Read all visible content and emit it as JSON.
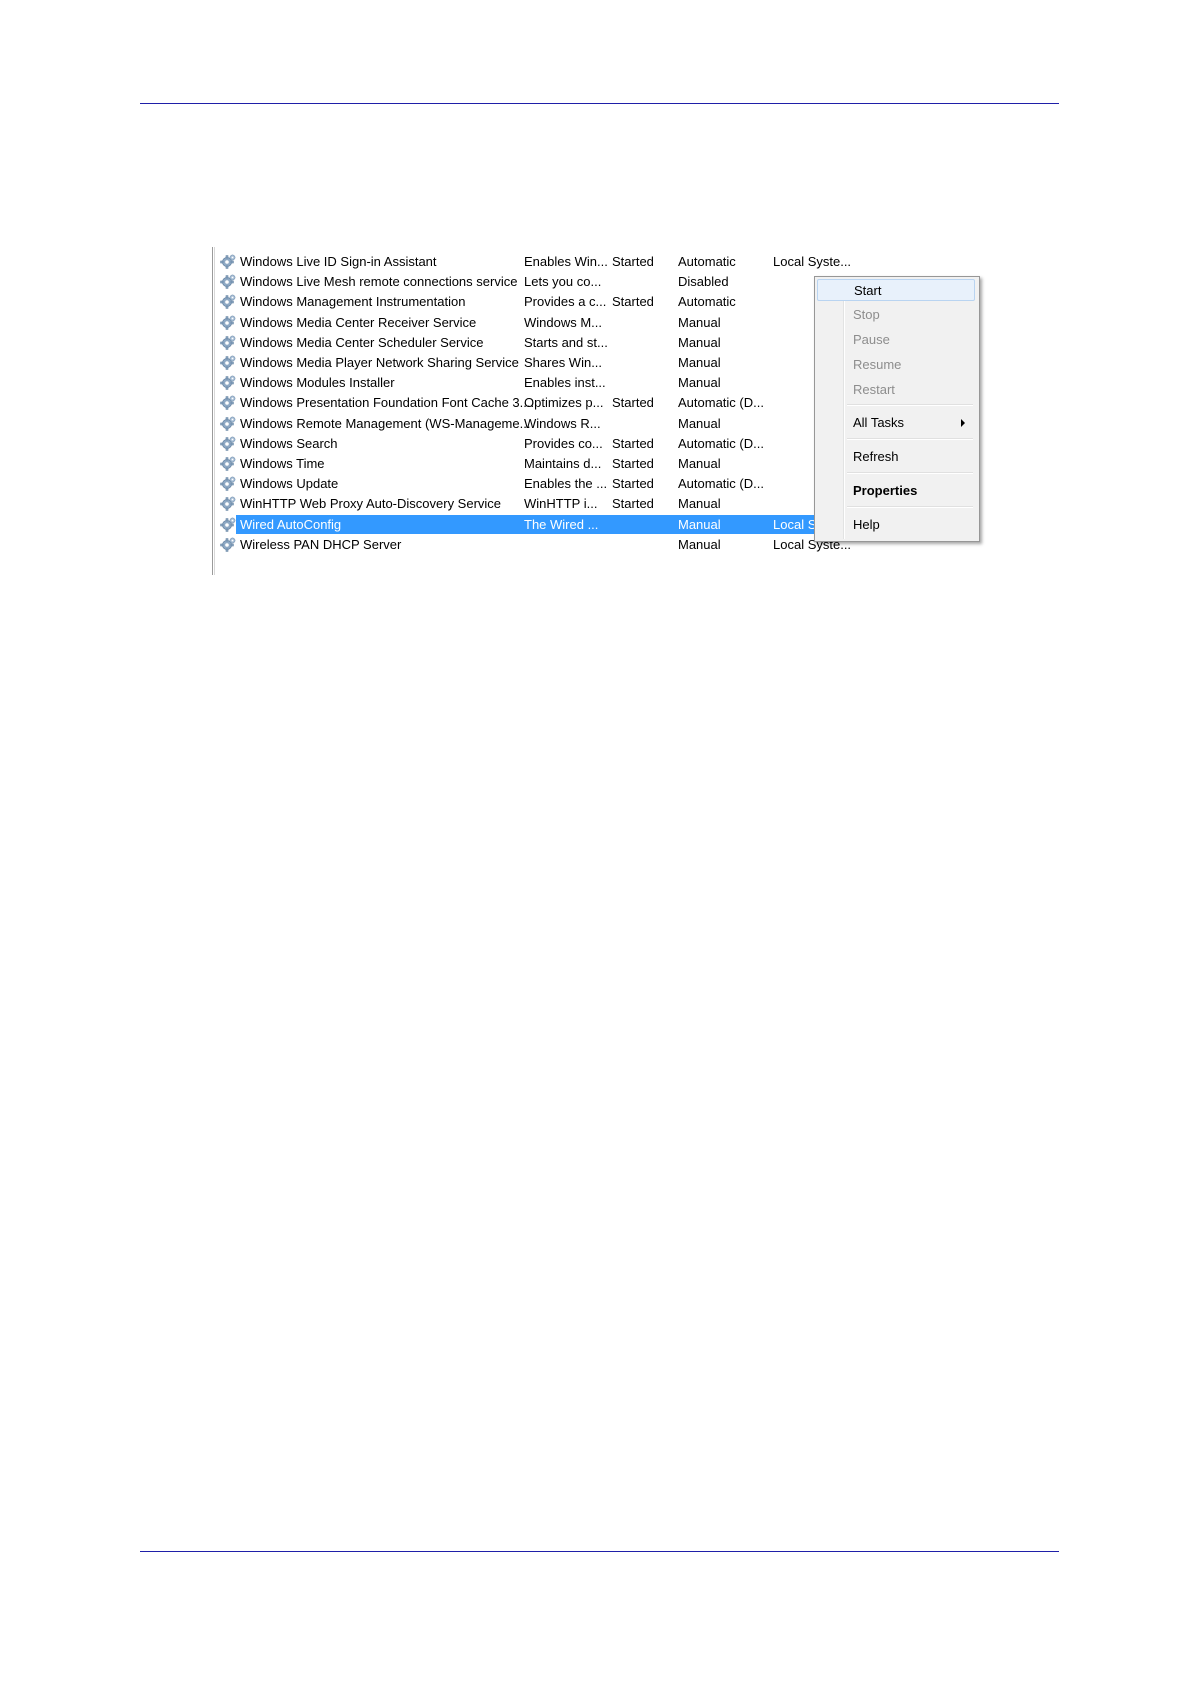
{
  "services": [
    {
      "name": "Windows Live ID Sign-in Assistant",
      "description": "Enables Win...",
      "status": "Started",
      "startup": "Automatic",
      "logon": "Local Syste...",
      "selected": false
    },
    {
      "name": "Windows Live Mesh remote connections service",
      "description": "Lets you co...",
      "status": "",
      "startup": "Disabled",
      "logon": "",
      "selected": false
    },
    {
      "name": "Windows Management Instrumentation",
      "description": "Provides a c...",
      "status": "Started",
      "startup": "Automatic",
      "logon": "",
      "selected": false
    },
    {
      "name": "Windows Media Center Receiver Service",
      "description": "Windows M...",
      "status": "",
      "startup": "Manual",
      "logon": "",
      "selected": false
    },
    {
      "name": "Windows Media Center Scheduler Service",
      "description": "Starts and st...",
      "status": "",
      "startup": "Manual",
      "logon": "",
      "selected": false
    },
    {
      "name": "Windows Media Player Network Sharing Service",
      "description": "Shares Win...",
      "status": "",
      "startup": "Manual",
      "logon": "",
      "selected": false
    },
    {
      "name": "Windows Modules Installer",
      "description": "Enables inst...",
      "status": "",
      "startup": "Manual",
      "logon": "",
      "selected": false
    },
    {
      "name": "Windows Presentation Foundation Font Cache 3....",
      "description": "Optimizes p...",
      "status": "Started",
      "startup": "Automatic (D...",
      "logon": "",
      "selected": false
    },
    {
      "name": "Windows Remote Management (WS-Manageme...",
      "description": "Windows R...",
      "status": "",
      "startup": "Manual",
      "logon": "",
      "selected": false
    },
    {
      "name": "Windows Search",
      "description": "Provides co...",
      "status": "Started",
      "startup": "Automatic (D...",
      "logon": "",
      "selected": false
    },
    {
      "name": "Windows Time",
      "description": "Maintains d...",
      "status": "Started",
      "startup": "Manual",
      "logon": "",
      "selected": false
    },
    {
      "name": "Windows Update",
      "description": "Enables the ...",
      "status": "Started",
      "startup": "Automatic (D...",
      "logon": "",
      "selected": false
    },
    {
      "name": "WinHTTP Web Proxy Auto-Discovery Service",
      "description": "WinHTTP i...",
      "status": "Started",
      "startup": "Manual",
      "logon": "",
      "selected": false
    },
    {
      "name": "Wired AutoConfig",
      "description": "The Wired ...",
      "status": "",
      "startup": "Manual",
      "logon": "Local Syste...",
      "selected": true
    },
    {
      "name": "Wireless PAN DHCP Server",
      "description": "",
      "status": "",
      "startup": "Manual",
      "logon": "Local Syste...",
      "selected": false
    }
  ],
  "context_menu": {
    "start": "Start",
    "stop": "Stop",
    "pause": "Pause",
    "resume": "Resume",
    "restart": "Restart",
    "all_tasks": "All Tasks",
    "refresh": "Refresh",
    "properties": "Properties",
    "help": "Help"
  },
  "colors": {
    "rule": "#1f1fa8",
    "selection": "#3399ff",
    "menu_hover": "#e8f1fb",
    "disabled_text": "#8d8d8d"
  }
}
